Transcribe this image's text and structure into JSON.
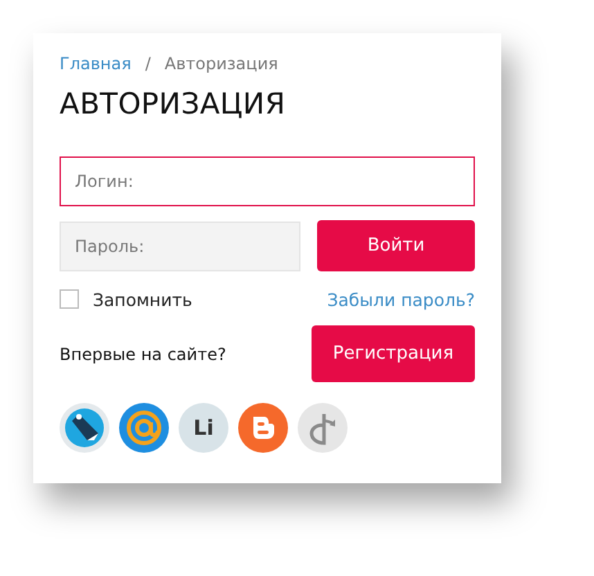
{
  "breadcrumbs": [
    {
      "label": "Главная",
      "link": true
    },
    {
      "label": "Авторизация",
      "link": false
    }
  ],
  "breadcrumb_separator": "/",
  "title": "АВТОРИЗАЦИЯ",
  "login_field": {
    "placeholder": "Логин:",
    "focused": true
  },
  "password_field": {
    "placeholder": "Пароль:",
    "focused": false
  },
  "login_button": "Войти",
  "remember": {
    "label": "Запомнить",
    "checked": false
  },
  "forgot_link": "Забыли пароль?",
  "first_visit": "Впервые на сайте?",
  "register_button": "Регистрация",
  "social": [
    {
      "kind": "livejournal"
    },
    {
      "kind": "mailru"
    },
    {
      "kind": "liveinternet",
      "label": "Li"
    },
    {
      "kind": "blogger"
    },
    {
      "kind": "openid"
    }
  ]
}
